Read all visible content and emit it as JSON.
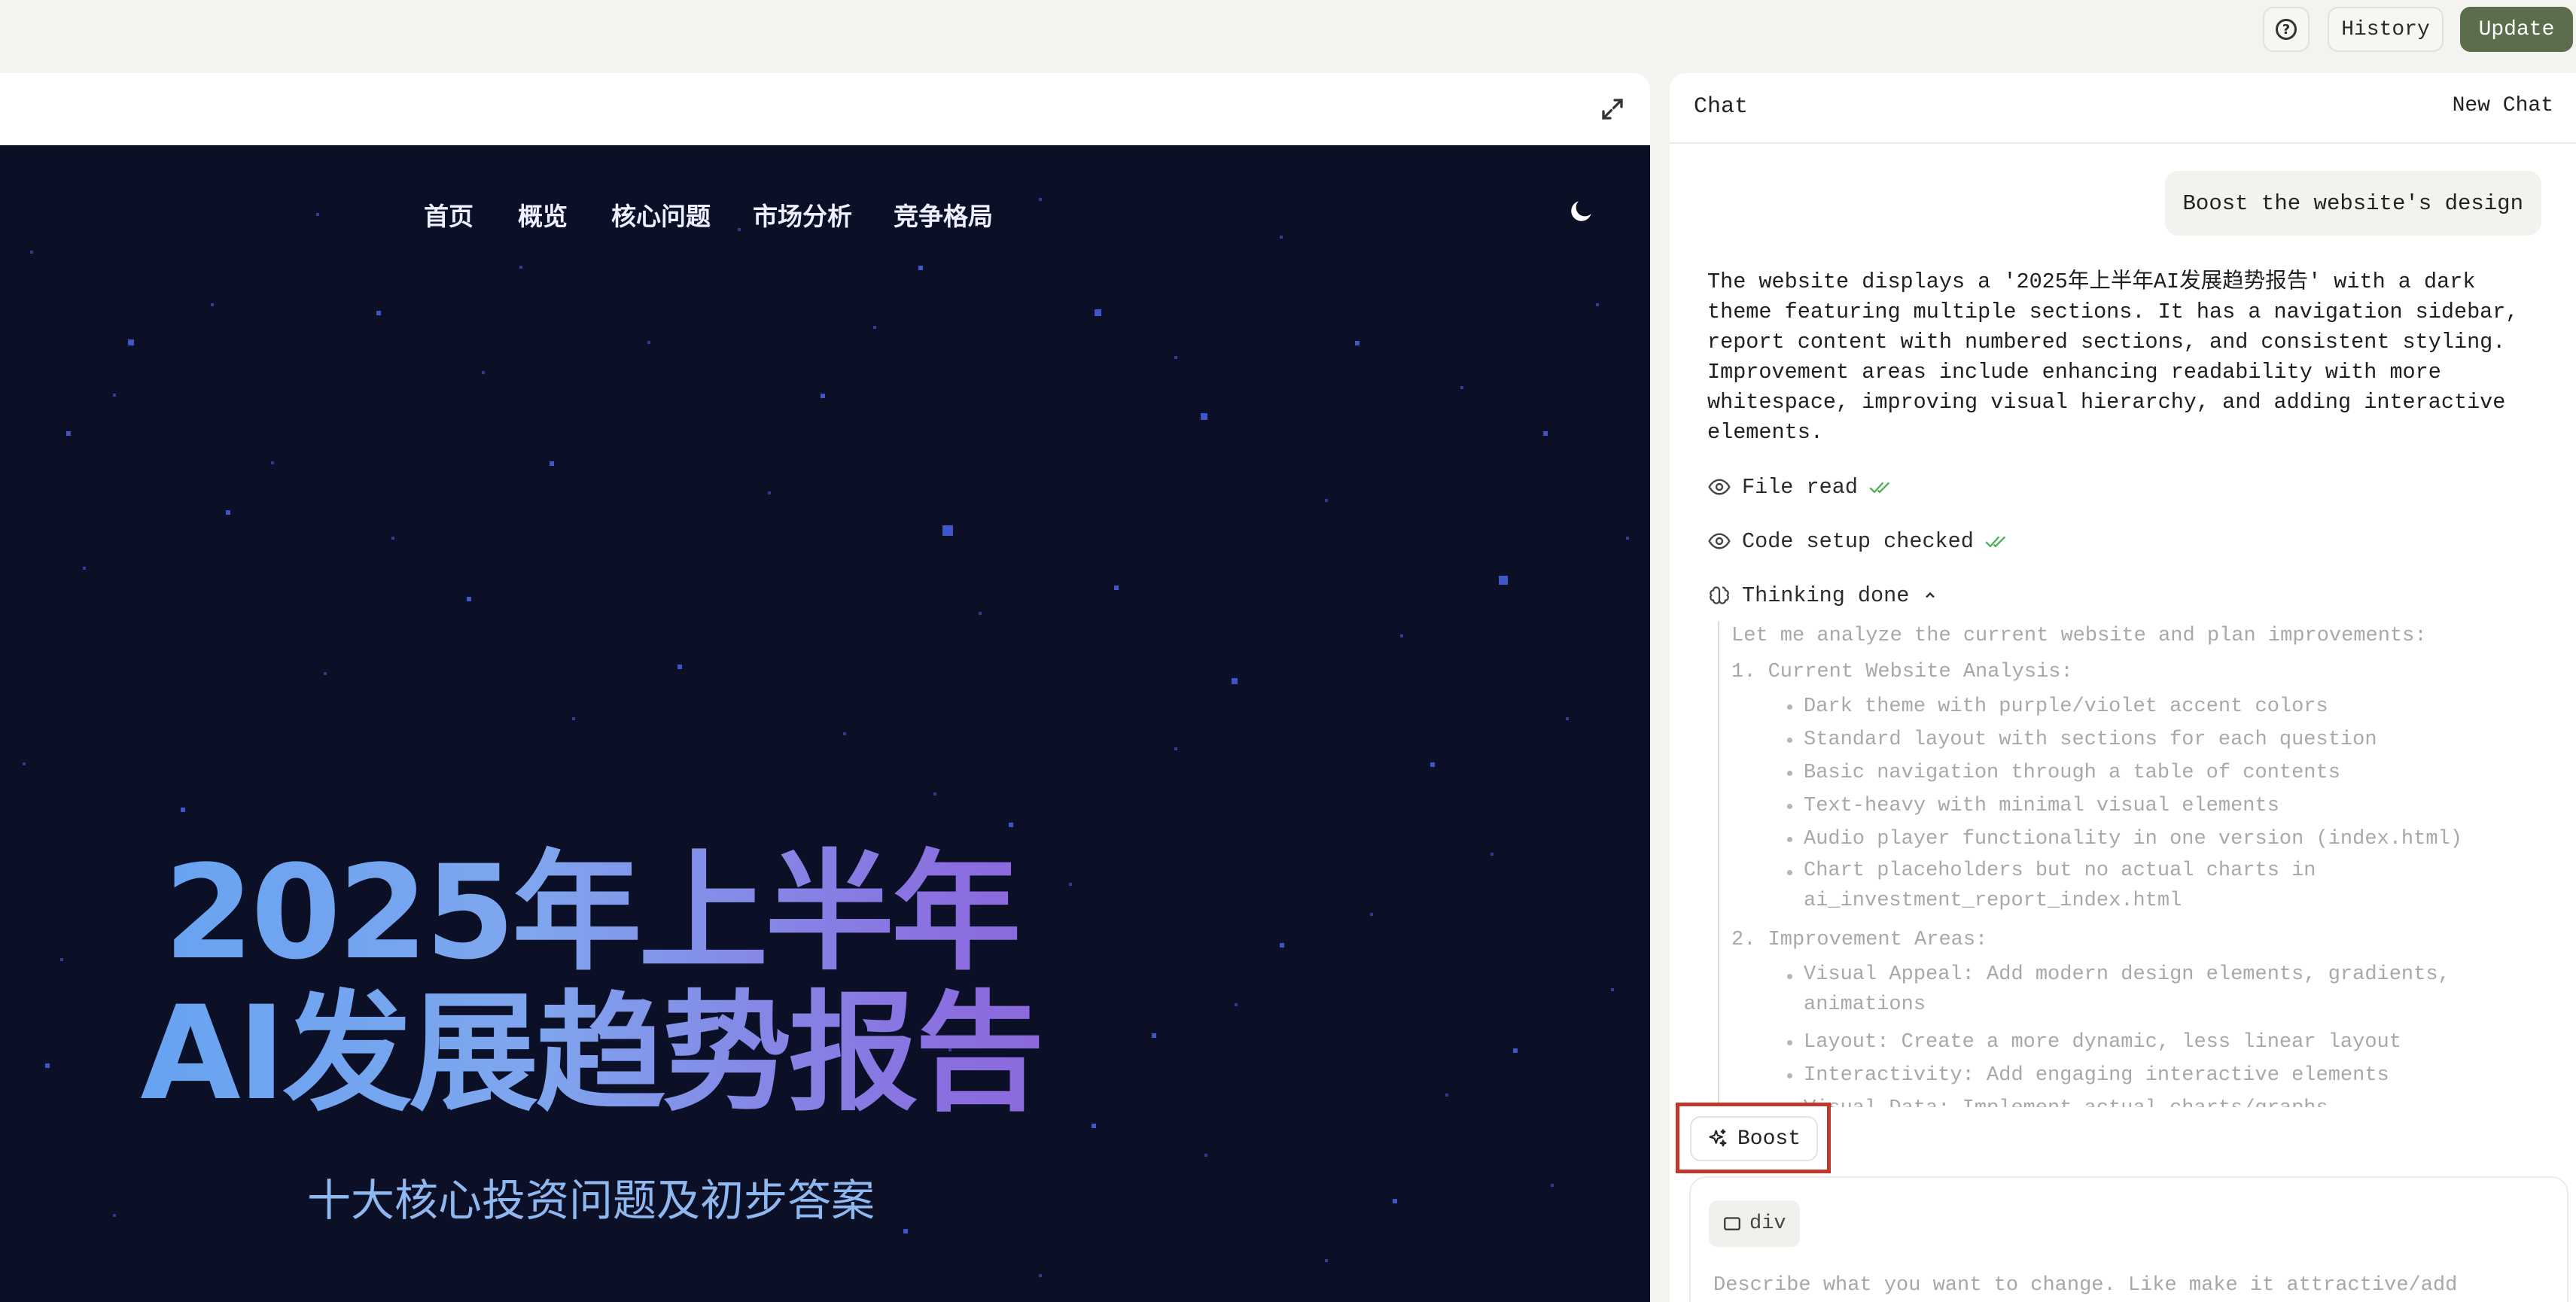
{
  "topbar": {
    "help_icon": "help-circle-icon",
    "history_label": "History",
    "update_label": "Update",
    "update_color": "#5b6d4c"
  },
  "preview": {
    "expand_icon": "expand-icon",
    "nav": [
      "首页",
      "概览",
      "核心问题",
      "市场分析",
      "竞争格局"
    ],
    "theme_icon": "moon-icon",
    "hero_line1": "2025年上半年",
    "hero_line2": "AI发展趋势报告",
    "hero_subtitle": "十大核心投资问题及初步答案",
    "background_color": "#0b1026"
  },
  "chat": {
    "title": "Chat",
    "new_chat_label": "New Chat",
    "user_message": "Boost the website's design",
    "assistant_text": "The website displays a '2025年上半年AI发展趋势报告' with a dark\ntheme featuring multiple sections. It has a navigation sidebar,\nreport content with numbered sections, and consistent styling.\nImprovement areas include enhancing readability with more\nwhitespace, improving visual hierarchy, and adding interactive\nelements.",
    "steps": [
      {
        "label": "File read",
        "icon": "eye-icon"
      },
      {
        "label": "Code setup checked",
        "icon": "eye-icon"
      },
      {
        "label": "Thinking done",
        "icon": "brain-icon"
      }
    ],
    "thinking": {
      "intro": "Let me analyze the current website and plan improvements:",
      "h1": "1. Current Website Analysis:",
      "analysis": [
        "Dark theme with purple/violet accent colors",
        "Standard layout with sections for each question",
        "Basic navigation through a table of contents",
        "Text-heavy with minimal visual elements",
        "Audio player functionality in one version (index.html)",
        "Chart placeholders but no actual charts in\nai_investment_report_index.html"
      ],
      "h2": "2. Improvement Areas:",
      "improvements": [
        "Visual Appeal: Add modern design elements, gradients,\nanimations",
        "Layout: Create a more dynamic, less linear layout",
        "Interactivity: Add engaging interactive elements",
        "Visual Data: Implement actual charts/graphs"
      ]
    },
    "boost_label": "Boost",
    "context_chip": "div",
    "input_placeholder": "Describe what you want to change. Like make it attractive/add"
  }
}
